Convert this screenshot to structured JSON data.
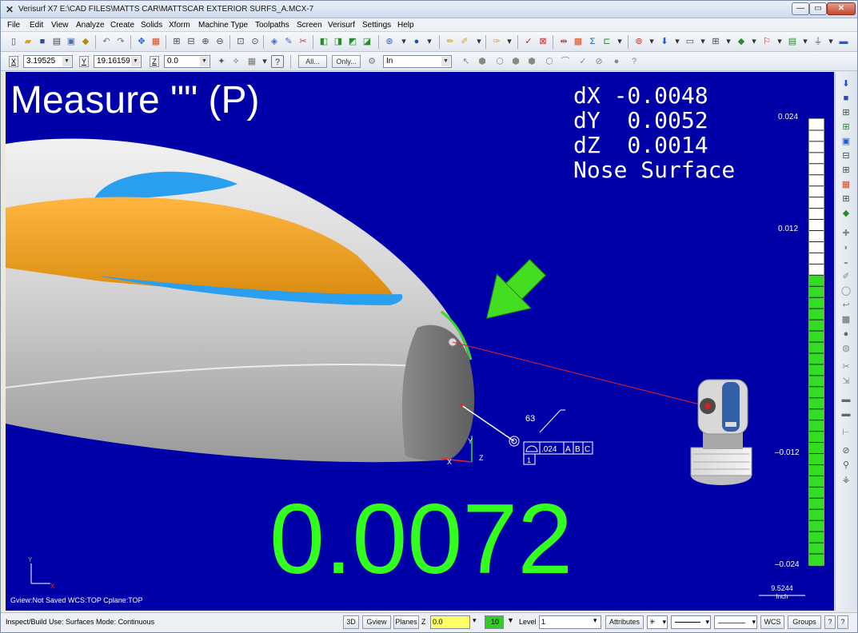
{
  "window": {
    "title": "Verisurf X7 E:\\CAD FILES\\MATTS CAR\\MATTSCAR EXTERIOR SURFS_A.MCX-7",
    "min_glyph": "—",
    "max_glyph": "▭",
    "close_glyph": "✕"
  },
  "menu": [
    "File",
    "Edit",
    "View",
    "Analyze",
    "Create",
    "Solids",
    "Xform",
    "Machine Type",
    "Toolpaths",
    "Screen",
    "Verisurf",
    "Settings",
    "Help"
  ],
  "coords": {
    "x_label": "X",
    "x_value": "3.19525",
    "y_label": "Y",
    "y_value": "19.16159",
    "z_label": "Z",
    "z_value": "0.0"
  },
  "toolbar2": {
    "all_label": "All...",
    "only_label": "Only...",
    "in_value": "In"
  },
  "viewport": {
    "measure_title": "Measure \"\" (P)",
    "dx": "dX -0.0048",
    "dy": "dY  0.0052",
    "dz": "dZ  0.0014",
    "surface_name": "Nose Surface",
    "big_value": "0.0072",
    "gview_info": "Gview:Not Saved   WCS:TOP   Cplane:TOP",
    "gauge": {
      "max": "0.024",
      "upper": "0.012",
      "lower": "–0.012",
      "min": "–0.024",
      "fill_fraction": 0.65
    },
    "scale_value": "9.5244",
    "scale_unit": "Inch",
    "gdt": {
      "count": "63",
      "tolerance": ".024",
      "datum_a": "A",
      "datum_b": "B",
      "datum_c": "C",
      "index": "1"
    },
    "axes": {
      "x": "X",
      "y": "Y",
      "z": "Z"
    },
    "colors": {
      "background": "#0000a8",
      "measure_green": "#33ff1f",
      "car_silver": "#c8c8c8",
      "car_orange": "#f0a020",
      "car_blue": "#2a9ff0"
    }
  },
  "statusbar": {
    "text": "Inspect/Build Use: Surfaces  Mode: Continuous",
    "btn_3d": "3D",
    "btn_gview": "Gview",
    "btn_planes": "Planes",
    "z_label": "Z",
    "z_value": "0.0",
    "color_value": "10",
    "level_label": "Level",
    "level_value": "1",
    "attributes": "Attributes",
    "wcs": "WCS",
    "groups": "Groups",
    "help1": "?",
    "help2": "?"
  }
}
